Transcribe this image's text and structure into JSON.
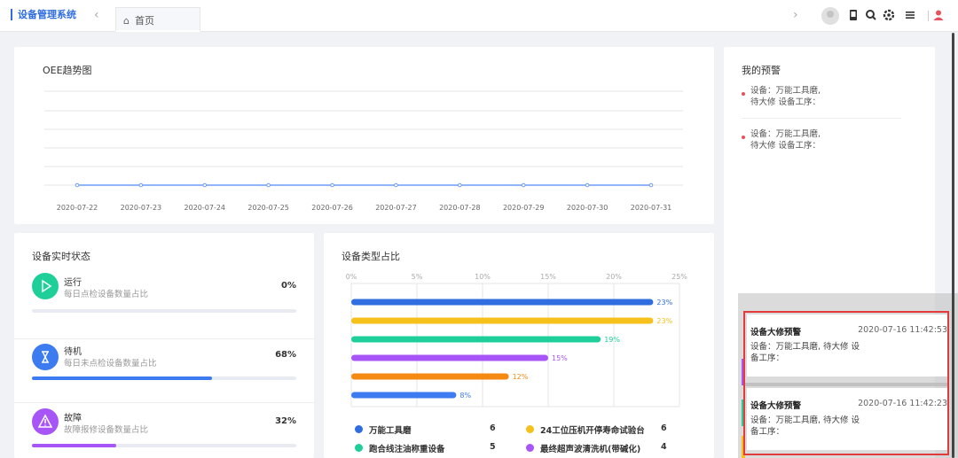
{
  "header": {
    "app_title": "设备管理系统",
    "tab_home_label": "首页",
    "icons": [
      "chevron-left-icon",
      "home-icon",
      "chevron-right-icon",
      "mobile-icon",
      "search-icon",
      "settings-icon",
      "menu-icon",
      "user-icon"
    ]
  },
  "oee": {
    "title": "OEE趋势图"
  },
  "warnings": {
    "title": "我的预警",
    "items": [
      {
        "line1": "设备：万能工具磨,",
        "line2": "待大修 设备工序："
      },
      {
        "line1": "设备：万能工具磨,",
        "line2": "待大修 设备工序："
      }
    ]
  },
  "status": {
    "title": "设备实时状态",
    "rows": [
      {
        "name": "运行",
        "desc": "每日点检设备数量占比",
        "percent_label": "0%",
        "percent": 0,
        "color": "#1fcf9a",
        "icon": "play-icon"
      },
      {
        "name": "待机",
        "desc": "每日未点检设备数量占比",
        "percent_label": "68%",
        "percent": 68,
        "color": "#3d7bf0",
        "icon": "hourglass-icon"
      },
      {
        "name": "故障",
        "desc": "故障报修设备数量占比",
        "percent_label": "32%",
        "percent": 32,
        "color": "#a855f7",
        "icon": "warning-icon"
      }
    ]
  },
  "types": {
    "title": "设备类型占比",
    "legend": [
      {
        "name": "万能工具磨",
        "count": "6",
        "color": "#2f6de1"
      },
      {
        "name": "24工位压机开停寿命试验台",
        "count": "6",
        "color": "#f5c11a"
      },
      {
        "name": "跑合线注油称重设备",
        "count": "5",
        "color": "#1fcf9a"
      },
      {
        "name": "最终超声波清洗机(带碱化)",
        "count": "4",
        "color": "#a855f7"
      }
    ]
  },
  "notifications": [
    {
      "title": "设备大修预警",
      "time": "2020-07-16 11:42:53",
      "body": "设备：万能工具磨, 待大修 设备工序："
    },
    {
      "title": "设备大修预警",
      "time": "2020-07-16 11:42:23",
      "body": "设备：万能工具磨, 待大修 设备工序："
    }
  ],
  "chart_data": [
    {
      "type": "line",
      "title": "OEE趋势图",
      "x": [
        "2020-07-22",
        "2020-07-23",
        "2020-07-24",
        "2020-07-25",
        "2020-07-26",
        "2020-07-27",
        "2020-07-28",
        "2020-07-29",
        "2020-07-30",
        "2020-07-31"
      ],
      "series": [
        {
          "values": [
            0,
            0,
            0,
            0,
            0,
            0,
            0,
            0,
            0,
            0
          ],
          "color": "#6e9bf5"
        }
      ],
      "grid": true
    },
    {
      "type": "bar",
      "orientation": "horizontal",
      "title": "设备类型占比",
      "xticks": [
        "0%",
        "5%",
        "10%",
        "15%",
        "20%",
        "25%"
      ],
      "xlim": [
        0,
        25
      ],
      "bars": [
        {
          "value": 23,
          "label": "23%",
          "color": "#2f6de1"
        },
        {
          "value": 23,
          "label": "23%",
          "color": "#f5c11a"
        },
        {
          "value": 19,
          "label": "19%",
          "color": "#1fcf9a"
        },
        {
          "value": 15,
          "label": "15%",
          "color": "#a855f7"
        },
        {
          "value": 12,
          "label": "12%",
          "color": "#f58a12"
        },
        {
          "value": 8,
          "label": "8%",
          "color": "#3d7bf0"
        }
      ],
      "grid": true
    }
  ]
}
